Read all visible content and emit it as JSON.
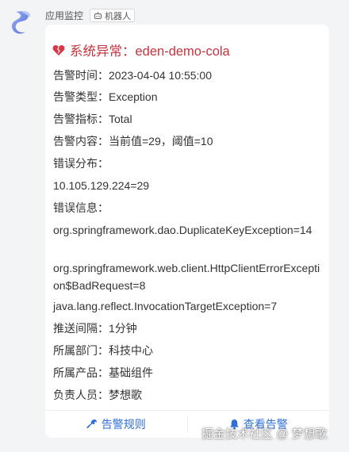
{
  "sender": {
    "name": "应用监控",
    "bot_tag": "机器人"
  },
  "card": {
    "title": "系统异常：eden-demo-cola",
    "fields": [
      "告警时间：2023-04-04 10:55:00",
      "告警类型：Exception",
      "告警指标：Total",
      "告警内容：当前值=29，阈值=10",
      "错误分布：",
      "10.105.129.224=29",
      "错误信息：",
      "org.springframework.dao.DuplicateKeyException=14",
      "org.springframework.web.client.HttpClientErrorException$BadRequest=8",
      "java.lang.reflect.InvocationTargetException=7",
      "推送间隔：1分钟",
      "所属部门：科技中心",
      "所属产品：基础组件",
      "负责人员：梦想歌"
    ],
    "actions": {
      "rules_label": "告警规则",
      "view_label": "查看告警"
    }
  },
  "watermark": "掘金技术社区 @ 梦想歌",
  "colors": {
    "title": "#c4333d",
    "action": "#2f6fd6"
  },
  "icons": {
    "title": "broken-heart-icon",
    "bot": "robot-icon",
    "rules": "wrench-icon",
    "view": "bell-icon"
  }
}
